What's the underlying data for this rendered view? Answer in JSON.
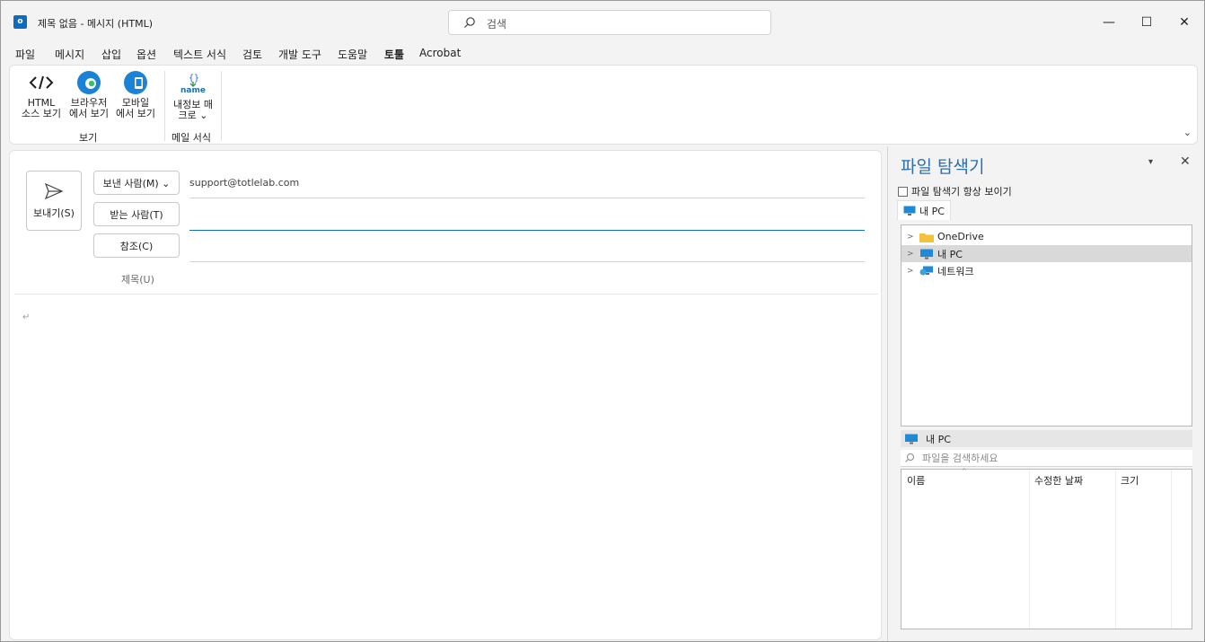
{
  "titlebar": {
    "app_icon_text": "o",
    "title": "제목 없음 - 메시지 (HTML)",
    "search_placeholder": "검색",
    "minimize": "—",
    "maximize": "☐",
    "close": "✕"
  },
  "menu": {
    "tabs": [
      "파일",
      "메시지",
      "삽입",
      "옵션",
      "텍스트 서식",
      "검토",
      "개발 도구",
      "도움말",
      "토툴",
      "Acrobat"
    ],
    "active_index": 8
  },
  "ribbon": {
    "buttons": {
      "html_source": {
        "line1": "HTML",
        "line2": "소스 보기"
      },
      "browser_view": {
        "line1": "브라우저",
        "line2": "에서 보기"
      },
      "mobile_view": {
        "line1": "모바일",
        "line2": "에서 보기"
      },
      "macro": {
        "icon_text": "name",
        "line1": "내정보 매",
        "line2": "크로 ⌄"
      }
    },
    "groups": {
      "view": "보기",
      "mail_format": "메일 서식"
    },
    "collapse": "⌄"
  },
  "compose": {
    "send_label": "보내기(S)",
    "from_button": "보낸 사람(M) ⌄",
    "from_value": "support@totlelab.com",
    "to_button": "받는 사람(T)",
    "cc_button": "참조(C)",
    "subject_label": "제목(U)",
    "body_mark": "↵"
  },
  "explorer": {
    "title": "파일 탐색기",
    "dropdown": "▾",
    "close": "✕",
    "always_show": "파일 탐색기 항상 보이기",
    "tab": "내 PC",
    "tree": [
      {
        "label": "OneDrive",
        "icon": "folder-icon"
      },
      {
        "label": "내 PC",
        "icon": "monitor-icon"
      },
      {
        "label": "네트워크",
        "icon": "network-icon"
      }
    ],
    "selected_tree_index": 1,
    "location": "내 PC",
    "file_search_placeholder": "파일을 검색하세요",
    "columns": {
      "name": "이름",
      "modified": "수정한 날짜",
      "size": "크기"
    }
  },
  "colors": {
    "accent": "#0f6cbd",
    "title_blue": "#2e6fad"
  }
}
